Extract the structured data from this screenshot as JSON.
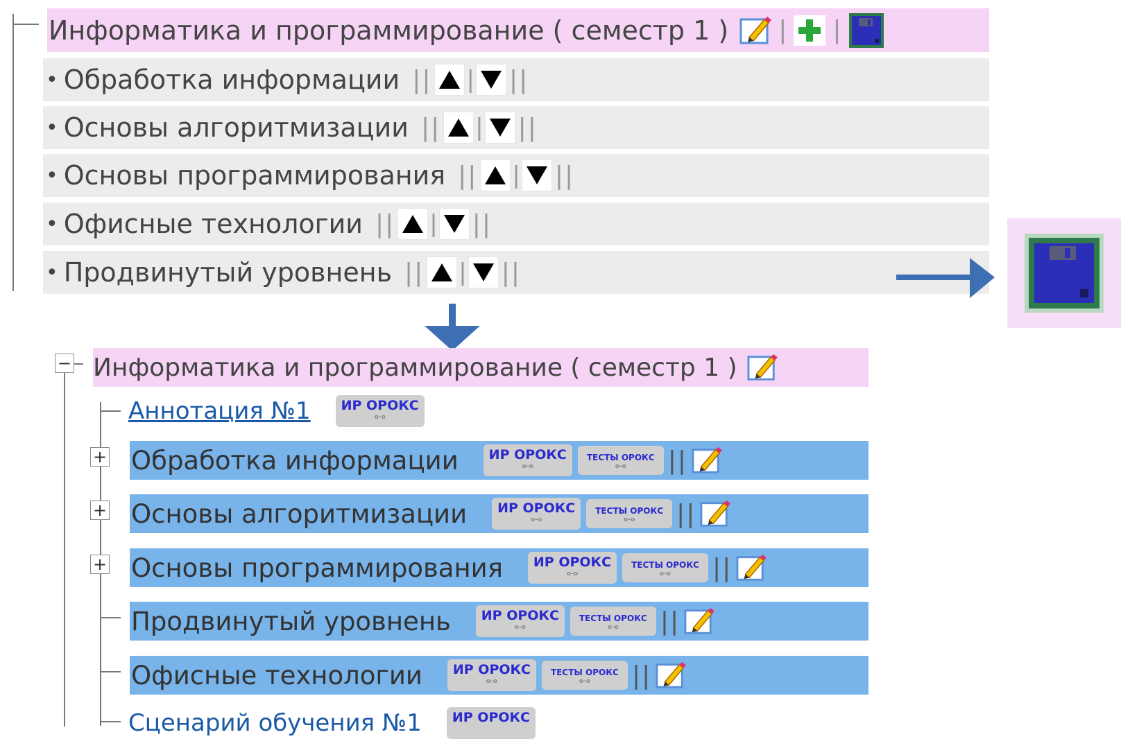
{
  "top_panel": {
    "header": {
      "title": "Информатика и программирование ( семестр 1 )",
      "separator": "|",
      "edit_icon": "pencil-edit-icon",
      "add_icon": "green-plus-icon",
      "save_icon": "floppy-disk-icon"
    },
    "bullet": "•",
    "bars": "||",
    "pipe": "|",
    "items": [
      {
        "label": "Обработка информации"
      },
      {
        "label": "Основы алгоритмизации"
      },
      {
        "label": "Основы программирования"
      },
      {
        "label": "Офисные технологии"
      },
      {
        "label": "Продвинутый уровнень"
      }
    ]
  },
  "bottom_panel": {
    "header": {
      "title": "Информатика и программирование ( семестр 1 )",
      "collapse_symbol": "−"
    },
    "annotation": {
      "label": "Аннотация №1"
    },
    "badge_ir": "ИР ОРОКС",
    "badge_test": "ТЕСТЫ ОРОКС",
    "badge_sub": "о-о",
    "bars": "||",
    "expand_symbol": "+",
    "items": [
      {
        "label": "Обработка информации"
      },
      {
        "label": "Основы алгоритмизации"
      },
      {
        "label": "Основы программирования"
      },
      {
        "label": "Продвинутый уровнень"
      },
      {
        "label": "Офисные технологии"
      }
    ],
    "scenario": {
      "label": "Сценарий обучения №1"
    }
  },
  "colors": {
    "header_pink": "#f6d4f6",
    "row_gray": "#ececec",
    "row_blue": "#78b4ea",
    "arrow_blue": "#3f6fb3"
  }
}
